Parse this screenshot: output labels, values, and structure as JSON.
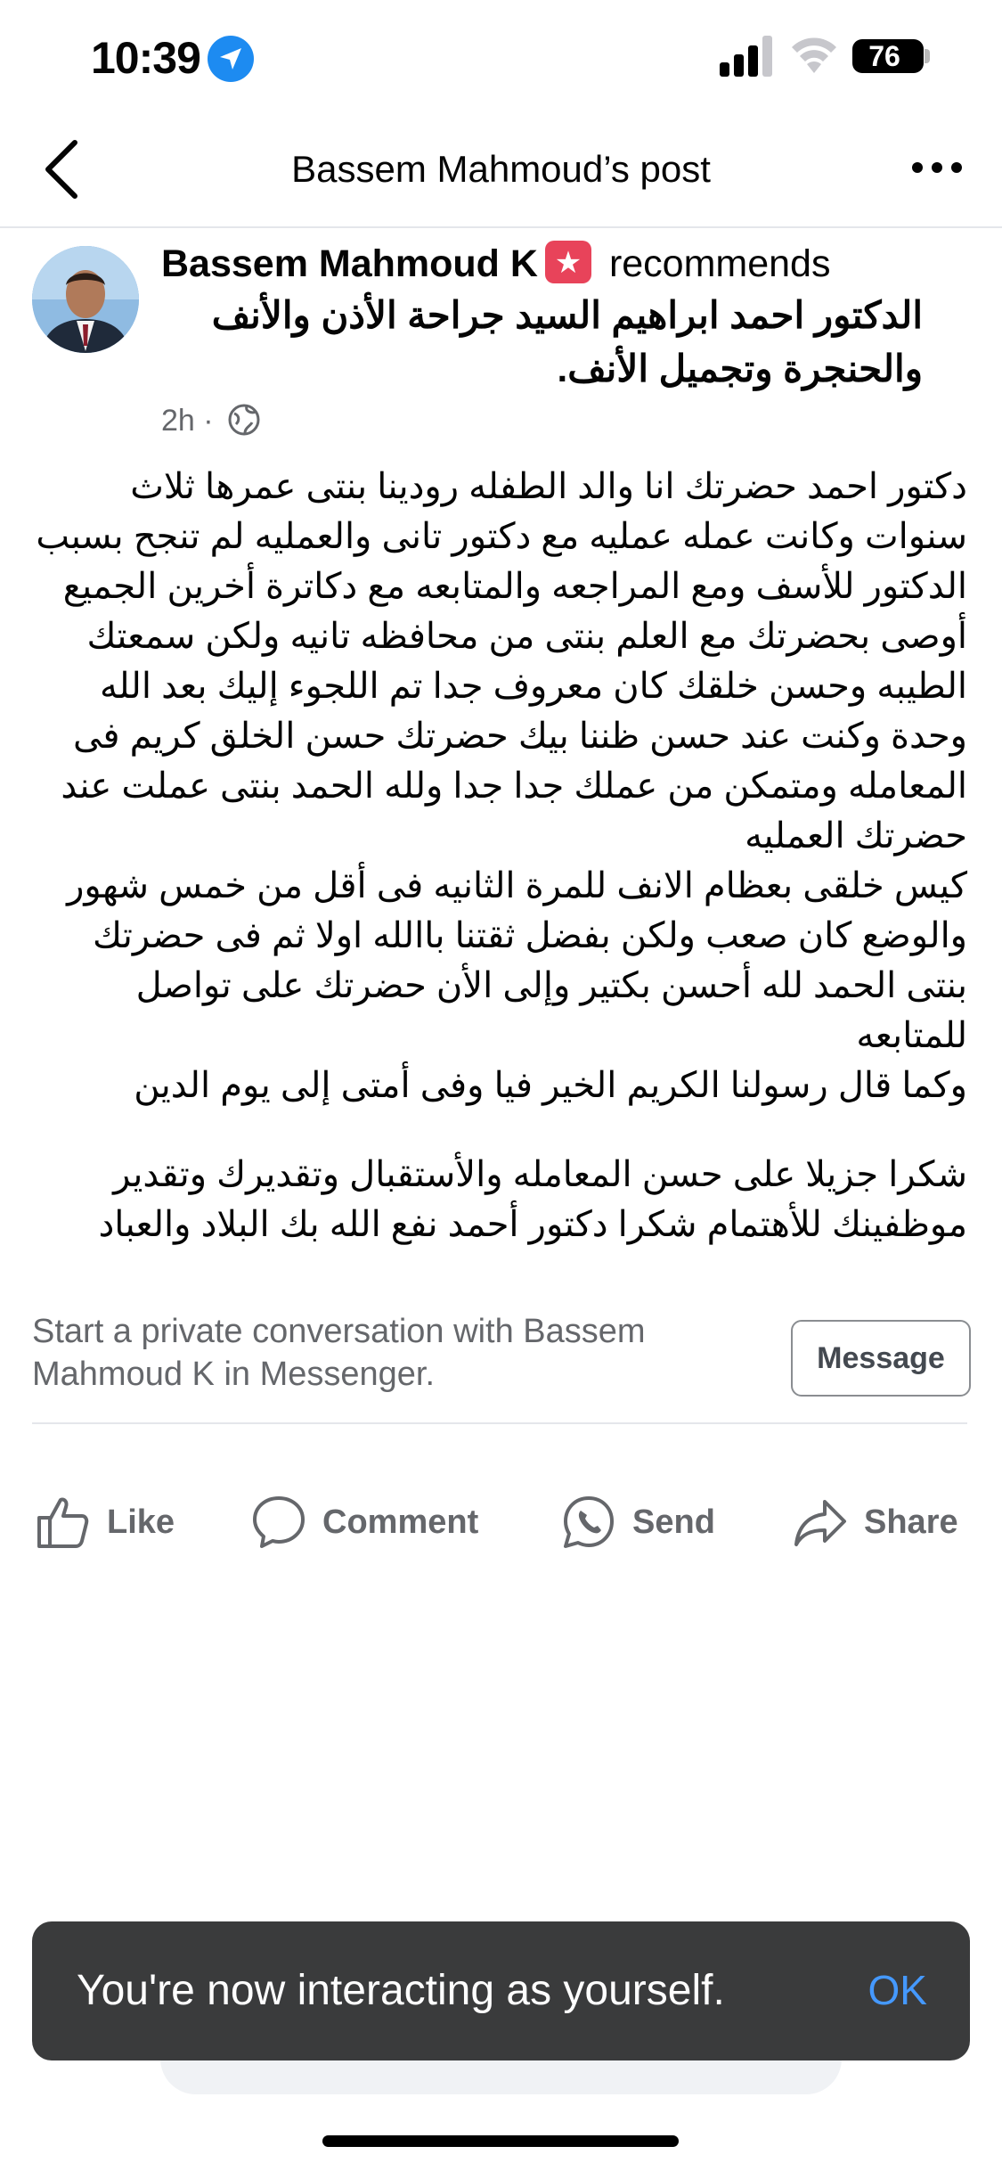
{
  "status_bar": {
    "time": "10:39",
    "battery": "76"
  },
  "nav": {
    "title": "Bassem Mahmoud’s post"
  },
  "post": {
    "author": "Bassem Mahmoud K",
    "verb": "recommends",
    "page_name": "الدكتور احمد ابراهيم السيد جراحة الأذن والأنف والحنجرة وتجميل الأنف.",
    "time_ago": "2h",
    "separator": "·",
    "body": [
      "دكتور احمد حضرتك انا والد الطفله رودينا بنتى عمرها ثلاث سنوات وكانت عمله عمليه مع دكتور تانى والعمليه لم تنجح بسبب الدكتور للأسف ومع المراجعه والمتابعه مع دكاترة أخرين الجميع أوصى بحضرتك مع العلم بنتى من محافظه تانيه ولكن سمعتك الطيبه وحسن خلقك كان معروف جدا تم اللجوء إليك بعد الله وحدة وكنت عند حسن ظننا بيك حضرتك حسن الخلق كريم فى المعامله ومتمكن من عملك جدا جدا ولله الحمد بنتى عملت عند حضرتك العمليه",
      "كيس خلقى بعظام الانف للمرة الثانيه فى أقل من خمس شهور والوضع كان صعب ولكن بفضل ثقتنا باالله اولا ثم فى حضرتك بنتى الحمد لله أحسن بكتير وإلى الأن حضرتك على تواصل للمتابعه",
      "وكما قال رسولنا الكريم الخير فيا وفى أمتى إلى يوم الدين",
      "شكرا جزيلا على حسن المعامله والأستقبال وتقديرك وتقدير موظفينك للأهتمام شكرا دكتور أحمد نفع الله بك البلاد والعباد"
    ]
  },
  "messenger": {
    "prompt": "Start a private conversation with Bassem Mahmoud K in Messenger.",
    "button_label": "Message"
  },
  "actions": {
    "like": "Like",
    "comment": "Comment",
    "send": "Send",
    "share": "Share"
  },
  "toast": {
    "message": "You're now interacting as yourself.",
    "ok_label": "OK"
  },
  "colors": {
    "link_blue": "#4599ff",
    "location_blue": "#1d8bf1",
    "badge_pink": "#e8435a",
    "secondary_text": "#65676b",
    "toast_bg": "#3a3b3c"
  },
  "icons": {
    "location": "location-arrow-icon",
    "signal": "cellular-signal-icon",
    "wifi": "wifi-icon",
    "battery": "battery-icon",
    "back": "chevron-left-icon",
    "more": "more-dots-icon",
    "recommend": "recommend-star-icon",
    "audience": "globe-icon",
    "like": "thumbs-up-icon",
    "comment": "comment-bubble-icon",
    "send": "whatsapp-icon",
    "share": "share-arrow-icon"
  }
}
